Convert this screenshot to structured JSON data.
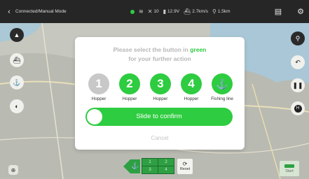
{
  "topbar": {
    "back_icon": "chevron-left-icon",
    "mode": "Connected/Manual Mode",
    "satellites": "10",
    "voltage": "12.9V",
    "speed": "2.7km/s",
    "distance": "1.5km",
    "status_color": "#2ecc40",
    "battery_color": "#e0a020"
  },
  "modal": {
    "title_pre": "Please select the button in ",
    "title_green": "green",
    "title_post": "for your further action",
    "choices": [
      {
        "value": "1",
        "label": "Hopper",
        "enabled": false
      },
      {
        "value": "2",
        "label": "Hopper",
        "enabled": true
      },
      {
        "value": "3",
        "label": "Hopper",
        "enabled": true
      },
      {
        "value": "4",
        "label": "Hopper",
        "enabled": true
      },
      {
        "value": "",
        "icon": "anchor-hook-icon",
        "label": "Fishing line",
        "enabled": true
      }
    ],
    "slider_label": "Slide to confirm",
    "cancel_label": "Cancel"
  },
  "bottom": {
    "grid": [
      "1",
      "2",
      "3",
      "4"
    ],
    "reset_label": "Reset",
    "start_label": "Start"
  },
  "colors": {
    "accent": "#2ecc40",
    "nav_green": "#2ea043",
    "disabled": "#c8c8c8",
    "topbar": "#262626"
  }
}
